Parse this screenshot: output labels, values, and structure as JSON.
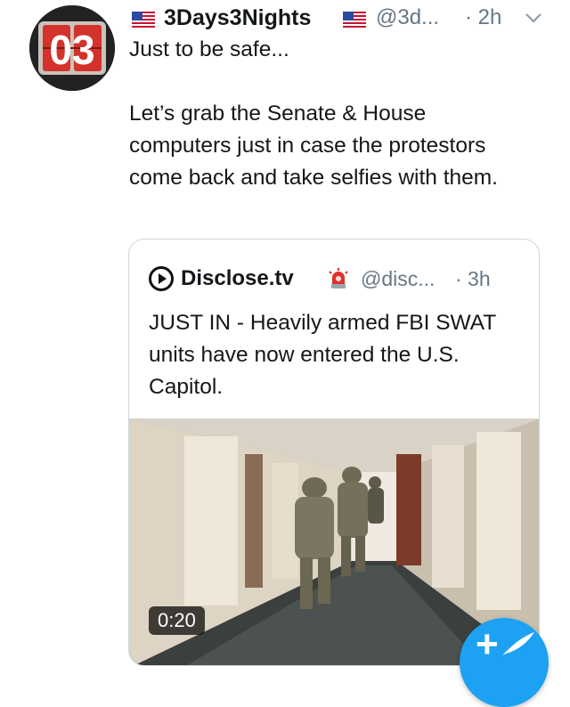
{
  "tweet": {
    "display_name": "3Days3Nights",
    "handle": "@3d...",
    "time": "· 2h",
    "text": "Just to be safe...\n\nLet’s grab the Senate & House computers just in case the protestors come back and take selfies with them.",
    "avatar_text": "03"
  },
  "quoted": {
    "display_name": "Disclose.tv",
    "handle": "@disc...",
    "time": "· 3h",
    "text": "JUST IN - Heavily armed FBI SWAT units have now entered the U.S. Capitol.",
    "media_duration": "0:20"
  },
  "fab": {
    "label": "+"
  },
  "colors": {
    "accent": "#1da1f2",
    "secondary_text": "#657786",
    "border": "#ccd6dd"
  },
  "icons": [
    "us-flag-icon",
    "chevron-down-icon",
    "disclose-logo-icon",
    "siren-icon",
    "compose-tweet-icon"
  ]
}
